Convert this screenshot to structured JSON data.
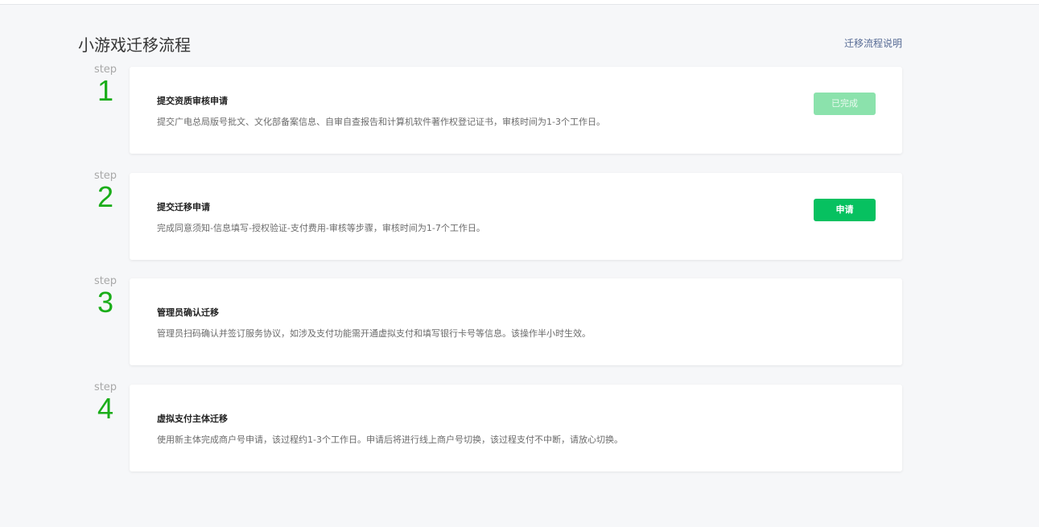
{
  "page": {
    "title": "小游戏迁移流程",
    "help_link": "迁移流程说明"
  },
  "step_label": "step",
  "steps": [
    {
      "number": "1",
      "title": "提交资质审核申请",
      "description": "提交广电总局版号批文、文化部备案信息、自审自查报告和计算机软件著作权登记证书，审核时间为1-3个工作日。",
      "button": "已完成",
      "button_state": "completed"
    },
    {
      "number": "2",
      "title": "提交迁移申请",
      "description": "完成同意须知-信息填写-授权验证-支付费用-审核等步骤，审核时间为1-7个工作日。",
      "button": "申请",
      "button_state": "active"
    },
    {
      "number": "3",
      "title": "管理员确认迁移",
      "description": "管理员扫码确认并签订服务协议，如涉及支付功能需开通虚拟支付和填写银行卡号等信息。该操作半小时生效。"
    },
    {
      "number": "4",
      "title": "虚拟支付主体迁移",
      "description": "使用新主体完成商户号申请，该过程约1-3个工作日。申请后将进行线上商户号切换，该过程支付不中断，请放心切换。"
    }
  ],
  "colors": {
    "accent": "#1aad19",
    "button_primary": "#07c160",
    "button_disabled": "#8be2ac",
    "link": "#576b95",
    "background": "#f6f7f9"
  }
}
